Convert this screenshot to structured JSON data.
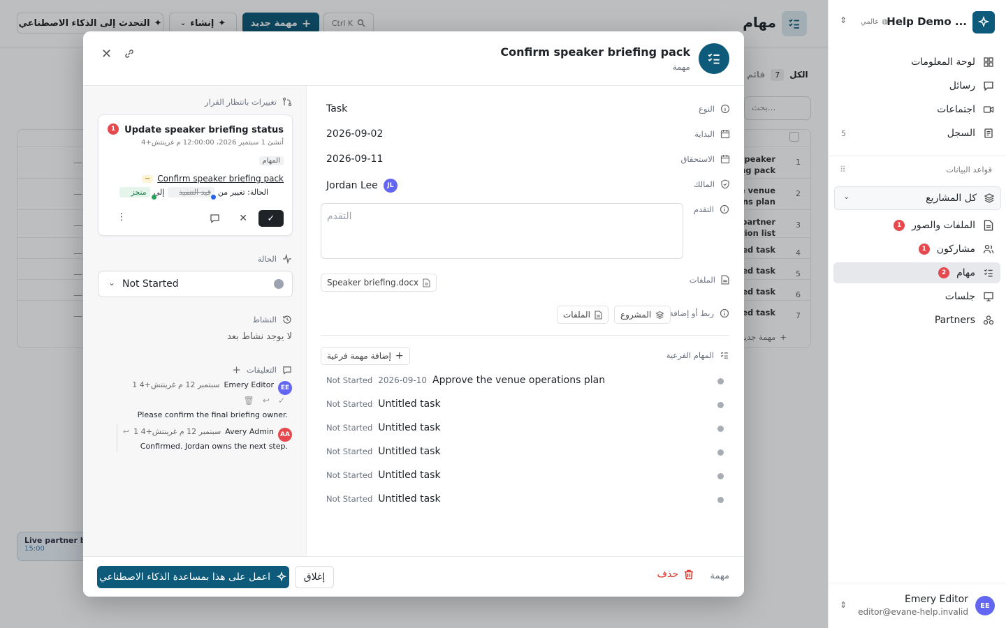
{
  "app": {
    "workspace_name": "Help Demo ...",
    "scope_label": "عالمي",
    "page_title": "مهام",
    "search_shortcut": "Ctrl K",
    "new_task_button": "مهمة جديد",
    "create_button": "إنشاء",
    "ai_chat_button": "التحدث إلى الذكاء الاصطناعي",
    "filter_all_label": "الكل",
    "filter_all_count": "7",
    "filter_list_label": "قائم",
    "search_placeholder": "بحث...",
    "background_rows": [
      {
        "num": "1",
        "title": "speaker ng pack"
      },
      {
        "num": "2",
        "title": "e venue ns plan"
      },
      {
        "num": "3",
        "title": "partner tion list"
      },
      {
        "num": "4",
        "title": "ed task"
      },
      {
        "num": "5",
        "title": "ed task"
      },
      {
        "num": "6",
        "title": "ed task"
      },
      {
        "num": "7",
        "title": "ed task"
      }
    ],
    "add_row_label": "مهمة جديد",
    "toast_title": "Live partner b",
    "toast_time": "15:00"
  },
  "sidebar": {
    "items": [
      {
        "label": "لوحة المعلومات",
        "icon": "dashboard-icon"
      },
      {
        "label": "رسائل",
        "icon": "message-icon"
      },
      {
        "label": "اجتماعات",
        "icon": "video-icon"
      },
      {
        "label": "السجل",
        "icon": "log-icon",
        "count": "5"
      }
    ],
    "databases_heading": "قواعد البيانات",
    "all_projects": "كل المشاريع",
    "db_items": [
      {
        "label": "الملفات والصور",
        "icon": "file-icon",
        "badge": "1"
      },
      {
        "label": "مشاركون",
        "icon": "users-icon",
        "badge": "1"
      },
      {
        "label": "مهام",
        "icon": "tasks-icon",
        "badge": "2",
        "selected": true
      },
      {
        "label": "جلسات",
        "icon": "presentation-icon"
      },
      {
        "label": "Partners",
        "icon": "partners-icon"
      }
    ],
    "user": {
      "name": "Emery Editor",
      "email": "editor@evane-help.invalid",
      "initials": "EE"
    }
  },
  "modal": {
    "title": "Confirm speaker briefing pack",
    "subtitle": "مهمة",
    "pending_changes_heading": "تغييرات بانتظار القرار",
    "change_card": {
      "badge": "1",
      "title": "Update speaker briefing status",
      "meta": "أنشئ 1 سبتمبر 2026، 12:00:00 م غرينتش+4",
      "table_tag": "المهام",
      "record_link": "Confirm speaker briefing pack",
      "change_prefix": "الحالة: تغيير من",
      "old_value": "قيد التنفيذ",
      "to_word": "إلى",
      "new_value": "منجز"
    },
    "status_heading": "الحالة",
    "status_value": "Not Started",
    "activity_heading": "النشاط",
    "activity_empty": "لا يوجد نشاط بعد",
    "comments_heading": "التعليقات",
    "comments": [
      {
        "initials": "EE",
        "author": "Emery Editor",
        "time": "1 سبتمبر 12 م غرينتش+4",
        "text": "Please confirm the final briefing owner."
      },
      {
        "initials": "AA",
        "author": "Avery Admin",
        "time": "1 سبتمبر 12 م غرينتش+4",
        "text": "Confirmed. Jordan owns the next step."
      }
    ],
    "properties": {
      "type_label": "النوع",
      "type_value": "Task",
      "start_label": "البداية",
      "start_value": "2026-09-02",
      "due_label": "الاستحقاق",
      "due_value": "2026-09-11",
      "owner_label": "المالك",
      "owner_value": "Jordan Lee",
      "owner_initials": "JL",
      "progress_label": "التقدم",
      "progress_placeholder": "التقدم",
      "files_label": "الملفات",
      "file_name": "Speaker briefing.docx",
      "link_label": "ربط أو إضافة",
      "link_project": "المشروع",
      "link_files": "الملفات"
    },
    "subtasks_label": "المهام الفرعية",
    "add_subtask_button": "إضافة مهمة فرعية",
    "subtasks": [
      {
        "status": "Not Started",
        "date": "2026-09-10",
        "title": "Approve the venue operations plan"
      },
      {
        "status": "Not Started",
        "date": "",
        "title": "Untitled task"
      },
      {
        "status": "Not Started",
        "date": "",
        "title": "Untitled task"
      },
      {
        "status": "Not Started",
        "date": "",
        "title": "Untitled task"
      },
      {
        "status": "Not Started",
        "date": "",
        "title": "Untitled task"
      },
      {
        "status": "Not Started",
        "date": "",
        "title": "Untitled task"
      }
    ],
    "footer": {
      "type_label": "مهمة",
      "delete_button": "حذف",
      "close_button": "إغلاق",
      "ai_button": "اعمل على هذا بمساعدة الذكاء الاصطناعي"
    }
  },
  "colors": {
    "primary": "#0d5a7a",
    "danger": "#d93025",
    "badge": "#e5484d",
    "success": "#22a35a",
    "avatar": "#6366f1"
  }
}
